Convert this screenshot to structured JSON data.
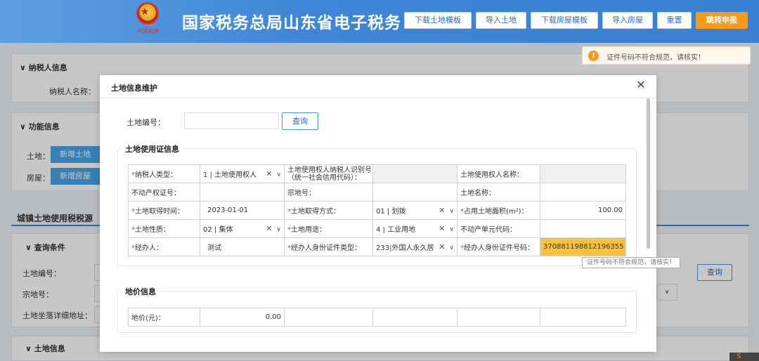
{
  "header": {
    "title": "国家税务总局山东省电子税务",
    "emblem_text": "中国税务",
    "buttons": {
      "download_land_template": "下载土地模板",
      "import_land": "导入土地",
      "download_house_template": "下载房屋模板",
      "import_house": "导入房屋",
      "reset": "重置",
      "jump_declare": "跳转申报"
    }
  },
  "background": {
    "taxpayer_section": "纳税人信息",
    "taxpayer_name_label": "纳税人名称：",
    "function_section": "功能信息",
    "land_label": "土地：",
    "add_land": "新增土地",
    "house_label": "房屋：",
    "add_house": "新增房屋",
    "urban_land_title": "城镇土地使用税税源",
    "query_conditions": "查询条件",
    "land_no_label": "土地编号：",
    "parcel_no_label": "宗地号：",
    "land_address_label": "土地坐落详细地址：",
    "query_button": "查询",
    "land_info_section": "土地信息"
  },
  "warning": {
    "text": "证件号码不符合规范，请核实！"
  },
  "modal": {
    "title": "土地信息维护",
    "land_no_label": "土地编号：",
    "land_no_value": "",
    "query_button": "查询",
    "cert_section": "土地使用证信息",
    "price_section": "地价信息",
    "rows": {
      "taxpayer_type_label": "纳税人类型：",
      "taxpayer_type_value": "1 | 土地使用权人",
      "user_tin_label_1": "土地使用权人纳税人识别号",
      "user_tin_label_2": "（统一社会信用代码）：",
      "user_tin_value": "",
      "user_name_label": "土地使用权人名称：",
      "user_name_value": "",
      "property_cert_label": "不动产权证号：",
      "property_cert_value": "",
      "parcel_no_label": "宗地号：",
      "parcel_no_value": "",
      "land_name_label": "土地名称：",
      "land_name_value": "",
      "acquire_time_label": "土地取得时间：",
      "acquire_time_value": "2023-01-01",
      "acquire_method_label": "土地取得方式：",
      "acquire_method_value": "01 | 划拨",
      "area_label": "占用土地面积(m²)：",
      "area_value": "100.00",
      "land_nature_label": "土地性质：",
      "land_nature_value": "02 | 集体",
      "land_use_label": "土地用途：",
      "land_use_value": "4 | 工业用地",
      "property_unit_label": "不动产单元代码：",
      "property_unit_value": "",
      "agent_label": "经办人：",
      "agent_value": "测试",
      "agent_id_type_label": "经办人身份证件类型：",
      "agent_id_type_value": "233|外国人永久居",
      "agent_id_no_label": "经办人身份证件号码：",
      "agent_id_no_value": "370881198812196355"
    },
    "price_label": "地价(元)：",
    "price_value": "0.00",
    "tooltip": "证件号码不符合规范，请核实！"
  }
}
